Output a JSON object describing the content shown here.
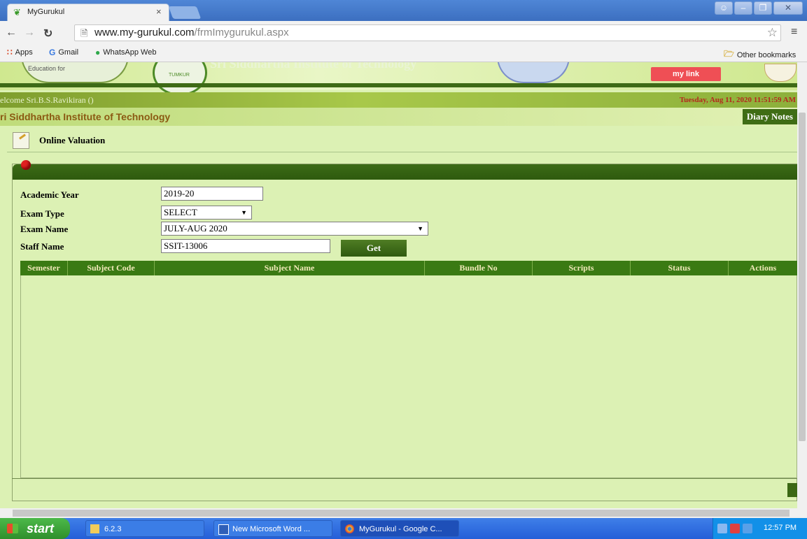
{
  "browser": {
    "tab_title": "MyGurukul",
    "tab_close": "×",
    "url_host": "www.my-gurukul.com",
    "url_path": "/frmImygurukul.aspx",
    "bookmarks": [
      "Apps",
      "Gmail",
      "WhatsApp Web"
    ],
    "other_bookmarks": "Other bookmarks"
  },
  "banner": {
    "logo_text": "Education for",
    "seal_text": "TUMKUR",
    "headline": "Sri Siddhartha Institute of Technology",
    "my_link": "my link"
  },
  "header": {
    "welcome": "elcome Sri.B.S.Ravikiran ()",
    "datetime": "Tuesday, Aug 11, 2020 11:51:59 AM",
    "institute": "ri Siddhartha Institute of Technology",
    "diary_notes": "Diary Notes"
  },
  "section": {
    "title": "Online Valuation"
  },
  "form": {
    "academic_year_label": "Academic Year",
    "academic_year_value": "2019-20",
    "exam_type_label": "Exam Type",
    "exam_type_value": "SELECT",
    "exam_name_label": "Exam Name",
    "exam_name_value": "JULY-AUG 2020",
    "staff_name_label": "Staff Name",
    "staff_name_value": "SSIT-13006",
    "get_button": "Get"
  },
  "grid": {
    "columns": [
      "Semester",
      "Subject Code",
      "Subject Name",
      "Bundle No",
      "Scripts",
      "Status",
      "Actions"
    ],
    "rows": []
  },
  "taskbar": {
    "start": "start",
    "tasks": [
      "6.2.3",
      "New Microsoft Word ...",
      "MyGurukul - Google C..."
    ],
    "clock": "12:57 PM"
  },
  "colors": {
    "page_bg": "#dcf1b4",
    "header_green": "#3a7a13",
    "date_red": "#b4291d",
    "institute_brown": "#8b5a12"
  }
}
